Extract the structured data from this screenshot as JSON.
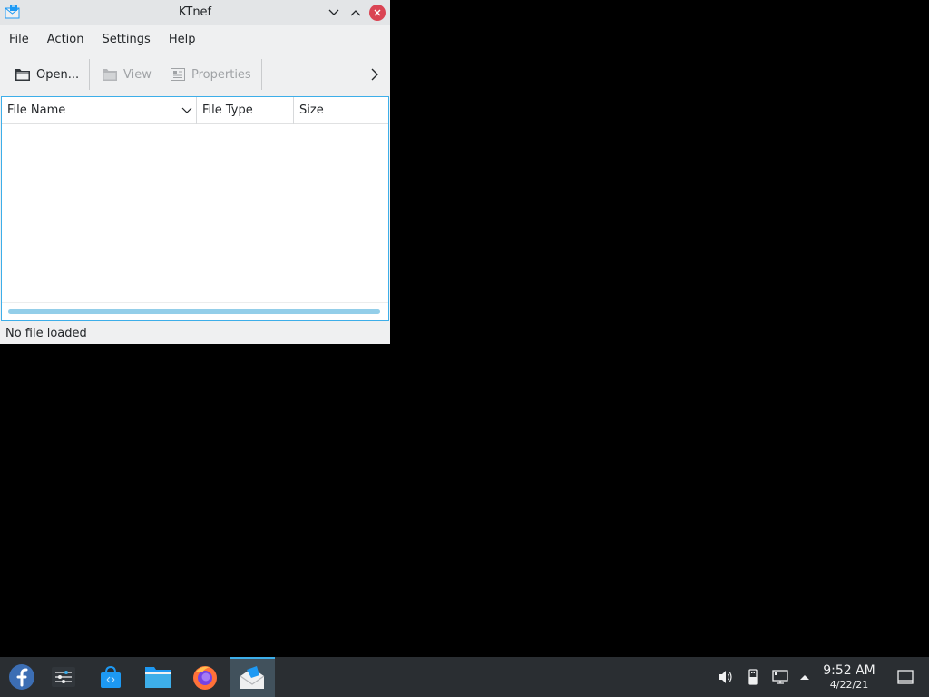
{
  "window": {
    "title": "KTnef",
    "accent_color": "#3daee9",
    "close_color": "#da4453"
  },
  "menubar": {
    "items": [
      "File",
      "Action",
      "Settings",
      "Help"
    ]
  },
  "toolbar": {
    "open_label": "Open...",
    "view_label": "View",
    "properties_label": "Properties",
    "icons": [
      "folder-open-icon",
      "folder-icon",
      "properties-icon",
      "chevron-right-icon"
    ]
  },
  "listview": {
    "columns": [
      "File Name",
      "File Type",
      "Size"
    ],
    "rows": []
  },
  "statusbar": {
    "text": "No file loaded"
  },
  "taskbar": {
    "tasks": [
      "fedora-launcher-icon",
      "system-settings-icon",
      "discover-store-icon",
      "file-manager-icon",
      "firefox-icon",
      "ktnef-mail-icon"
    ],
    "tray_icons": [
      "volume-icon",
      "usb-icon",
      "network-icon",
      "expand-tray-icon"
    ],
    "clock_time": "9:52 AM",
    "clock_date": "4/22/21"
  }
}
